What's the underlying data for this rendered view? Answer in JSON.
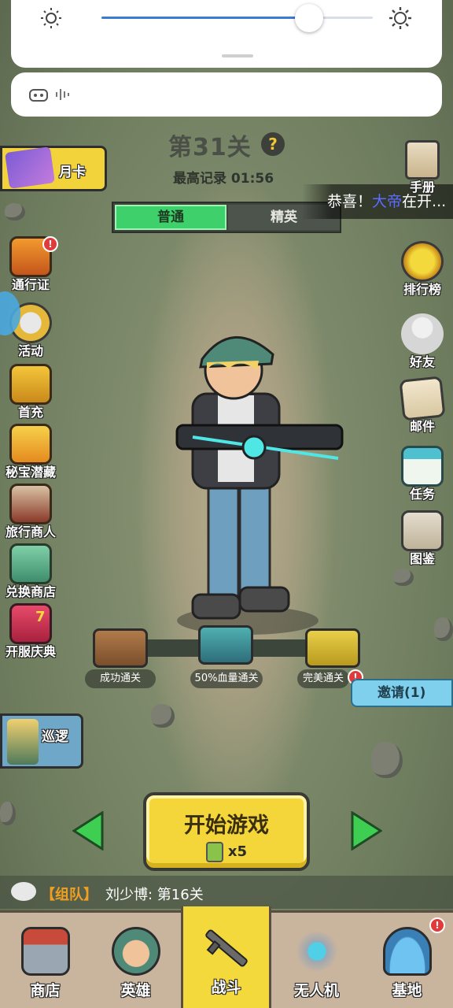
{
  "quick_settings": {
    "brightness": 0.77,
    "accent": "#3a7bd5"
  },
  "header": {
    "level_title": "第31关",
    "help_label": "?",
    "best_record": "最高记录 01:56",
    "modes": [
      "普通",
      "精英"
    ]
  },
  "banner": {
    "prefix": "恭喜！",
    "name": "大帝",
    "suffix": "在开..."
  },
  "left_menu": {
    "month_card": "月卡",
    "items": [
      {
        "label": "通行证"
      },
      {
        "label": "活动"
      },
      {
        "label": "首充"
      },
      {
        "label": "秘宝潜藏"
      },
      {
        "label": "旅行商人"
      },
      {
        "label": "兑换商店"
      },
      {
        "label": "开服庆典",
        "badge_number": "7"
      }
    ],
    "badge_mark": "!",
    "patrol": "巡逻"
  },
  "right_menu": {
    "items": [
      {
        "label": "手册"
      },
      {
        "label": "排行榜"
      },
      {
        "label": "好友"
      },
      {
        "label": "邮件"
      },
      {
        "label": "任务"
      },
      {
        "label": "图鉴"
      }
    ]
  },
  "chests": [
    {
      "label": "成功通关"
    },
    {
      "label": "50%血量通关"
    },
    {
      "label": "完美通关"
    }
  ],
  "invite": "邀请(1)",
  "start_button": {
    "label": "开始游戏",
    "cost": "x5"
  },
  "chat": {
    "tag": "【组队】",
    "message": "刘少博: 第16关"
  },
  "bottom_nav": [
    {
      "label": "商店"
    },
    {
      "label": "英雄"
    },
    {
      "label": "战斗"
    },
    {
      "label": "无人机"
    },
    {
      "label": "基地"
    }
  ],
  "colors": {
    "primary_yellow": "#f4d93c",
    "active_green": "#3ed06a",
    "badge_red": "#e23a3a"
  }
}
